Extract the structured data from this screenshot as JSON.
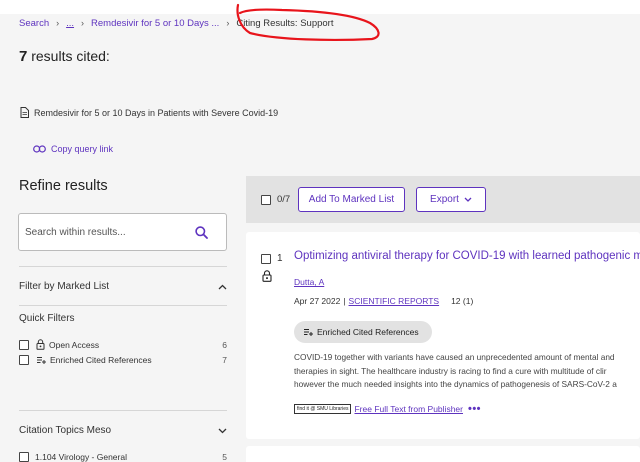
{
  "breadcrumb": {
    "items": [
      "Search",
      "...",
      "Remdesivir for 5 or 10 Days ..."
    ],
    "current": "Citing Results: Support"
  },
  "results": {
    "count": "7",
    "label": "results cited:"
  },
  "query": {
    "text": "Remdesivir for 5 or 10 Days in Patients with Severe Covid-19",
    "copy_label": "Copy query link"
  },
  "sidebar": {
    "refine_title": "Refine results",
    "search_placeholder": "Search within results...",
    "filter_marked_list": "Filter by Marked List",
    "quick_filters_title": "Quick Filters",
    "quick_filters": [
      {
        "label": "Open Access",
        "count": "6",
        "icon": "lock-icon"
      },
      {
        "label": "Enriched Cited References",
        "count": "7",
        "icon": "enriched-references-icon"
      }
    ],
    "citation_topics_title": "Citation Topics Meso",
    "citation_topics": [
      {
        "label": "1.104 Virology - General",
        "count": "5"
      }
    ]
  },
  "toolbar": {
    "selected": "0/7",
    "add_to_marked_list": "Add To Marked List",
    "export": "Export"
  },
  "record": {
    "number": "1",
    "title": "Optimizing antiviral therapy for COVID-19 with learned pathogenic m",
    "author": "Dutta, A",
    "date": "Apr 27 2022",
    "separator": "|",
    "journal": "SCIENTIFIC REPORTS",
    "volume": "12 (1)",
    "enriched_label": "Enriched Cited References",
    "abstract_lines": [
      "COVID-19 together with variants have caused an unprecedented amount of mental and",
      "therapies in sight. The healthcare industry is racing to find a cure with multitude of clir",
      "however the much needed insights into the dynamics of pathogenesis of SARS-CoV-2 a"
    ],
    "library_logo_text": "find it @ SMU Libraries",
    "full_text_label": "Free Full Text from Publisher",
    "more_label": "•••"
  },
  "colors": {
    "accent": "#5e33bf",
    "annotation": "#e8141b",
    "toolbar_bg": "#e2e2e2"
  }
}
